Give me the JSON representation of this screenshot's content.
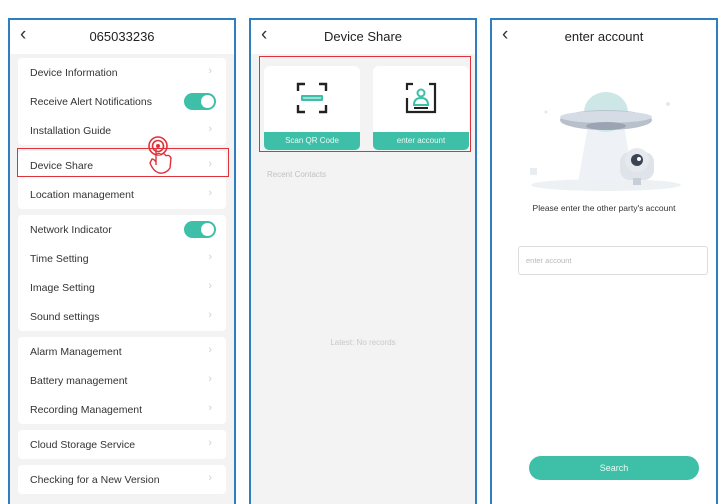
{
  "colors": {
    "accent": "#3dbfa8",
    "highlight": "#e0323a",
    "frame": "#2f7fc0"
  },
  "screen1": {
    "title": "065033236",
    "groups": [
      [
        {
          "label": "Device Information",
          "control": "chevron"
        },
        {
          "label": "Receive Alert Notifications",
          "control": "toggle-on"
        },
        {
          "label": "Installation Guide",
          "control": "chevron"
        }
      ],
      [
        {
          "label": "Device Share",
          "control": "chevron"
        },
        {
          "label": "Location management",
          "control": "chevron"
        }
      ],
      [
        {
          "label": "Network Indicator",
          "control": "toggle-on"
        },
        {
          "label": "Time Setting",
          "control": "chevron"
        },
        {
          "label": "Image Setting",
          "control": "chevron"
        },
        {
          "label": "Sound settings",
          "control": "chevron"
        }
      ],
      [
        {
          "label": "Alarm Management",
          "control": "chevron"
        },
        {
          "label": "Battery management",
          "control": "chevron"
        },
        {
          "label": "Recording Management",
          "control": "chevron"
        }
      ],
      [
        {
          "label": "Cloud Storage Service",
          "control": "chevron"
        }
      ],
      [
        {
          "label": "Checking for a New Version",
          "control": "chevron"
        }
      ]
    ]
  },
  "screen2": {
    "title": "Device Share",
    "scan_label": "Scan QR Code",
    "account_label": "enter account",
    "recent_label": "Recent Contacts",
    "empty_label": "Latest: No records"
  },
  "screen3": {
    "title": "enter account",
    "prompt": "Please enter the other party's account",
    "input_placeholder": "enter account",
    "search_label": "Search"
  }
}
